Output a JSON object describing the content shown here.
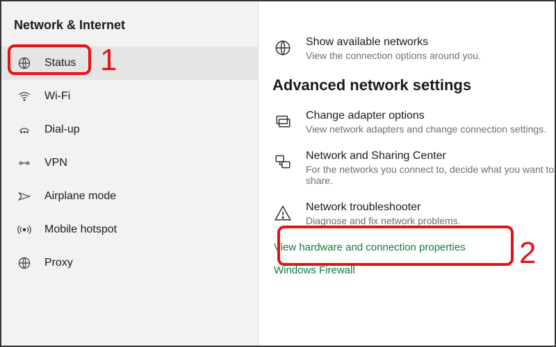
{
  "sidebar": {
    "title": "Network & Internet",
    "items": [
      {
        "label": "Status"
      },
      {
        "label": "Wi-Fi"
      },
      {
        "label": "Dial-up"
      },
      {
        "label": "VPN"
      },
      {
        "label": "Airplane mode"
      },
      {
        "label": "Mobile hotspot"
      },
      {
        "label": "Proxy"
      }
    ]
  },
  "main": {
    "available": {
      "title": "Show available networks",
      "desc": "View the connection options around you."
    },
    "section_heading": "Advanced network settings",
    "adapter": {
      "title": "Change adapter options",
      "desc": "View network adapters and change connection settings."
    },
    "sharing": {
      "title": "Network and Sharing Center",
      "desc": "For the networks you connect to, decide what you want to share."
    },
    "troubleshoot": {
      "title": "Network troubleshooter",
      "desc": "Diagnose and fix network problems."
    },
    "link_hw": "View hardware and connection properties",
    "link_fw": "Windows Firewall"
  },
  "annotations": {
    "n1": "1",
    "n2": "2"
  }
}
